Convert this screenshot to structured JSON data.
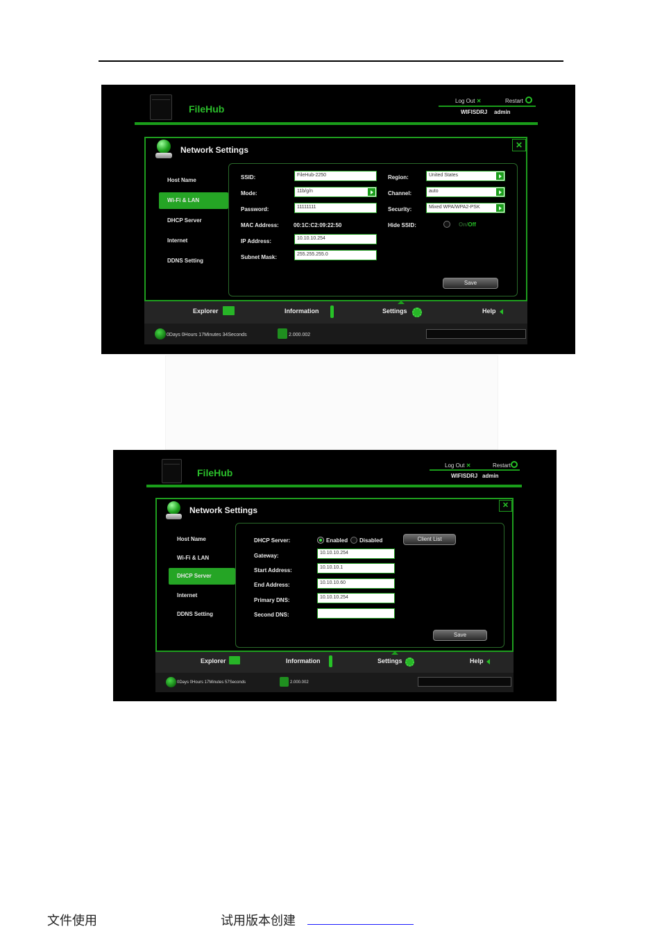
{
  "doc": {
    "footer_left": "文件使用",
    "footer_mid": "试用版本创建"
  },
  "shot1": {
    "app_title": "FileHub",
    "logout": "Log Out",
    "restart": "Restart",
    "device_name": "WIFISDRJ",
    "user": "admin",
    "panel_title": "Network Settings",
    "sidebar": [
      "Host Name",
      "Wi-Fi & LAN",
      "DHCP Server",
      "Internet",
      "DDNS Setting"
    ],
    "active_item": "Wi-Fi & LAN",
    "fields": {
      "ssid_label": "SSID:",
      "ssid": "FileHub-2250",
      "mode_label": "Mode:",
      "mode": "11b/g/n",
      "password_label": "Password:",
      "password": "11111111",
      "mac_label": "MAC Address:",
      "mac": "00:1C:C2:09:22:50",
      "ip_label": "IP Address:",
      "ip": "10.10.10.254",
      "subnet_label": "Subnet Mask:",
      "subnet": "255.255.255.0",
      "region_label": "Region:",
      "region": "United States",
      "channel_label": "Channel:",
      "channel": "auto",
      "security_label": "Security:",
      "security": "Mixed WPA/WPA2-PSK",
      "hide_label": "Hide SSID:",
      "hide_on": "On",
      "hide_sep": "/",
      "hide_off": "Off"
    },
    "save": "Save",
    "nav": {
      "explorer": "Explorer",
      "information": "Information",
      "settings": "Settings",
      "help": "Help"
    },
    "uptime": "0Days 0Hours 17Minutes 34Seconds",
    "version": "2.000.002"
  },
  "shot2": {
    "app_title": "FileHub",
    "logout": "Log Out",
    "restart": "Restart",
    "device_name": "WIFISDRJ",
    "user": "admin",
    "panel_title": "Network Settings",
    "sidebar": [
      "Host Name",
      "Wi-Fi & LAN",
      "DHCP Server",
      "Internet",
      "DDNS Setting"
    ],
    "active_item": "DHCP Server",
    "fields": {
      "dhcp_label": "DHCP Server:",
      "enabled": "Enabled",
      "disabled": "Disabled",
      "gateway_label": "Gateway:",
      "gateway": "10.10.10.254",
      "start_label": "Start Address:",
      "start": "10.10.10.1",
      "end_label": "End Address:",
      "end": "10.10.10.60",
      "pdns_label": "Primary DNS:",
      "pdns": "10.10.10.254",
      "sdns_label": "Second DNS:",
      "sdns": ""
    },
    "client_list": "Client List",
    "save": "Save",
    "nav": {
      "explorer": "Explorer",
      "information": "Information",
      "settings": "Settings",
      "help": "Help"
    },
    "uptime": "0Days 0Hours 17Minutes 57Seconds",
    "version": "2.000.002"
  }
}
